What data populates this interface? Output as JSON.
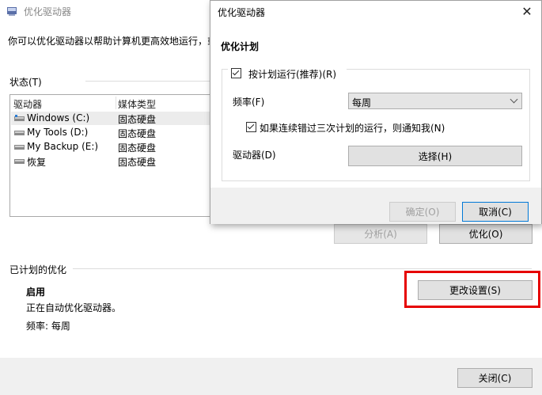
{
  "background": {
    "title": "优化驱动器",
    "description": "你可以优化驱动器以帮助计算机更高效地运行，或者",
    "status_label": "状态(T)",
    "columns": [
      "驱动器",
      "媒体类型"
    ],
    "drives": [
      {
        "name": "Windows (C:)",
        "type": "固态硬盘",
        "selected": true
      },
      {
        "name": "My Tools (D:)",
        "type": "固态硬盘",
        "selected": false
      },
      {
        "name": "My Backup (E:)",
        "type": "固态硬盘",
        "selected": false
      },
      {
        "name": "恢复",
        "type": "固态硬盘",
        "selected": false
      }
    ],
    "analyze_label": "分析(A)",
    "optimize_label": "优化(O)",
    "scheduled_label": "已计划的优化",
    "scheduled_status": "启用",
    "scheduled_desc": "正在自动优化驱动器。",
    "frequency_text": "频率: 每周",
    "change_settings_label": "更改设置(S)",
    "close_label": "关闭(C)"
  },
  "dialog": {
    "title": "优化驱动器",
    "close_glyph": "✕",
    "section_title": "优化计划",
    "run_on_schedule": "按计划运行(推荐)(R)",
    "run_on_schedule_checked": true,
    "frequency_label": "频率(F)",
    "frequency_value": "每周",
    "notify_label": "如果连续错过三次计划的运行，则通知我(N)",
    "notify_checked": true,
    "drives_label": "驱动器(D)",
    "choose_label": "选择(H)",
    "ok_label": "确定(O)",
    "cancel_label": "取消(C)"
  },
  "colors": {
    "highlight_border": "#e60000",
    "focus_border": "#0078d7"
  }
}
